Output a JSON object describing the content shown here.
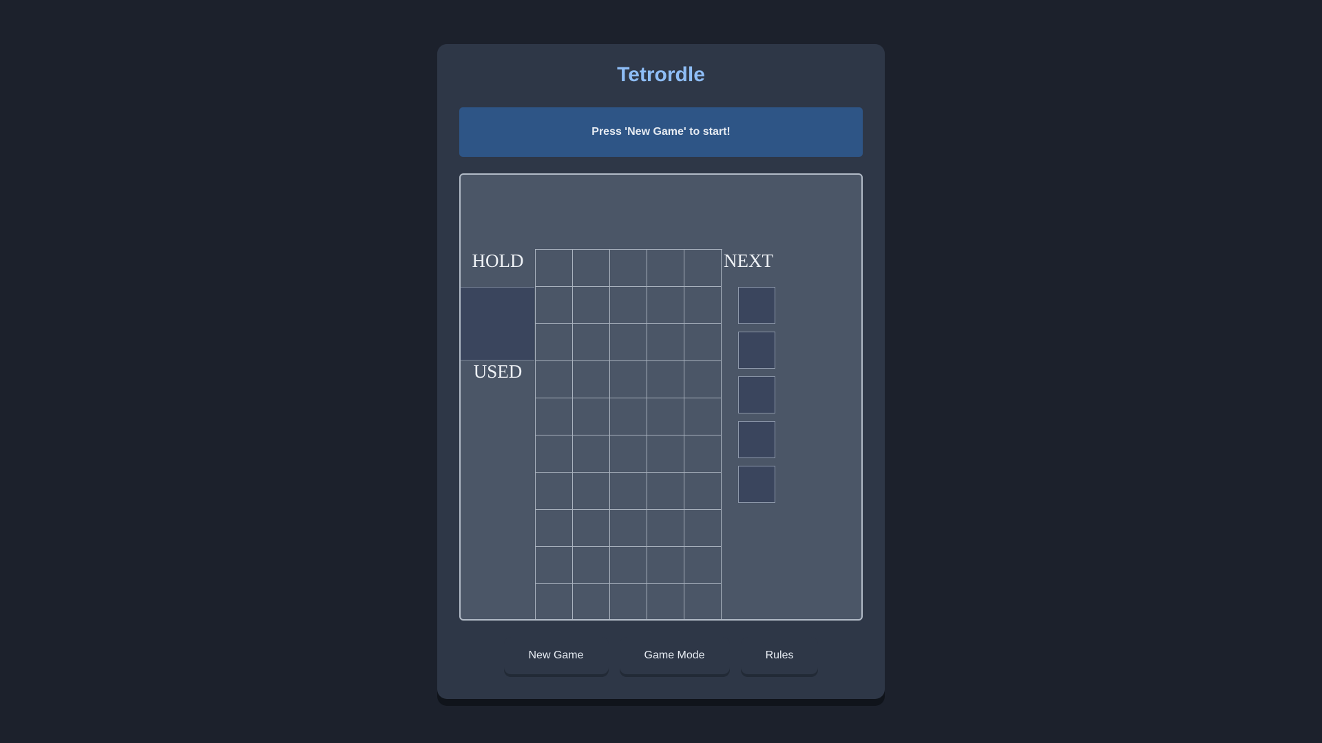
{
  "app": {
    "title": "Tetrordle"
  },
  "status": {
    "message": "Press 'New Game' to start!"
  },
  "board": {
    "hold_label": "HOLD",
    "used_label": "USED",
    "next_label": "NEXT",
    "grid": {
      "columns": 5,
      "rows": 10,
      "filled_cells": []
    },
    "next_queue": [
      {
        "piece": ""
      },
      {
        "piece": ""
      },
      {
        "piece": ""
      },
      {
        "piece": ""
      },
      {
        "piece": ""
      }
    ],
    "hold_piece": ""
  },
  "controls": {
    "new_game": "New Game",
    "game_mode": "Game Mode",
    "rules": "Rules"
  },
  "colors": {
    "title": "#8ebdf6",
    "status_bg": "#2e5586",
    "board_bg": "#4b5667",
    "slot_bg": "#3a455d",
    "page_bg": "#1c212c",
    "card_bg": "#2e3747"
  }
}
